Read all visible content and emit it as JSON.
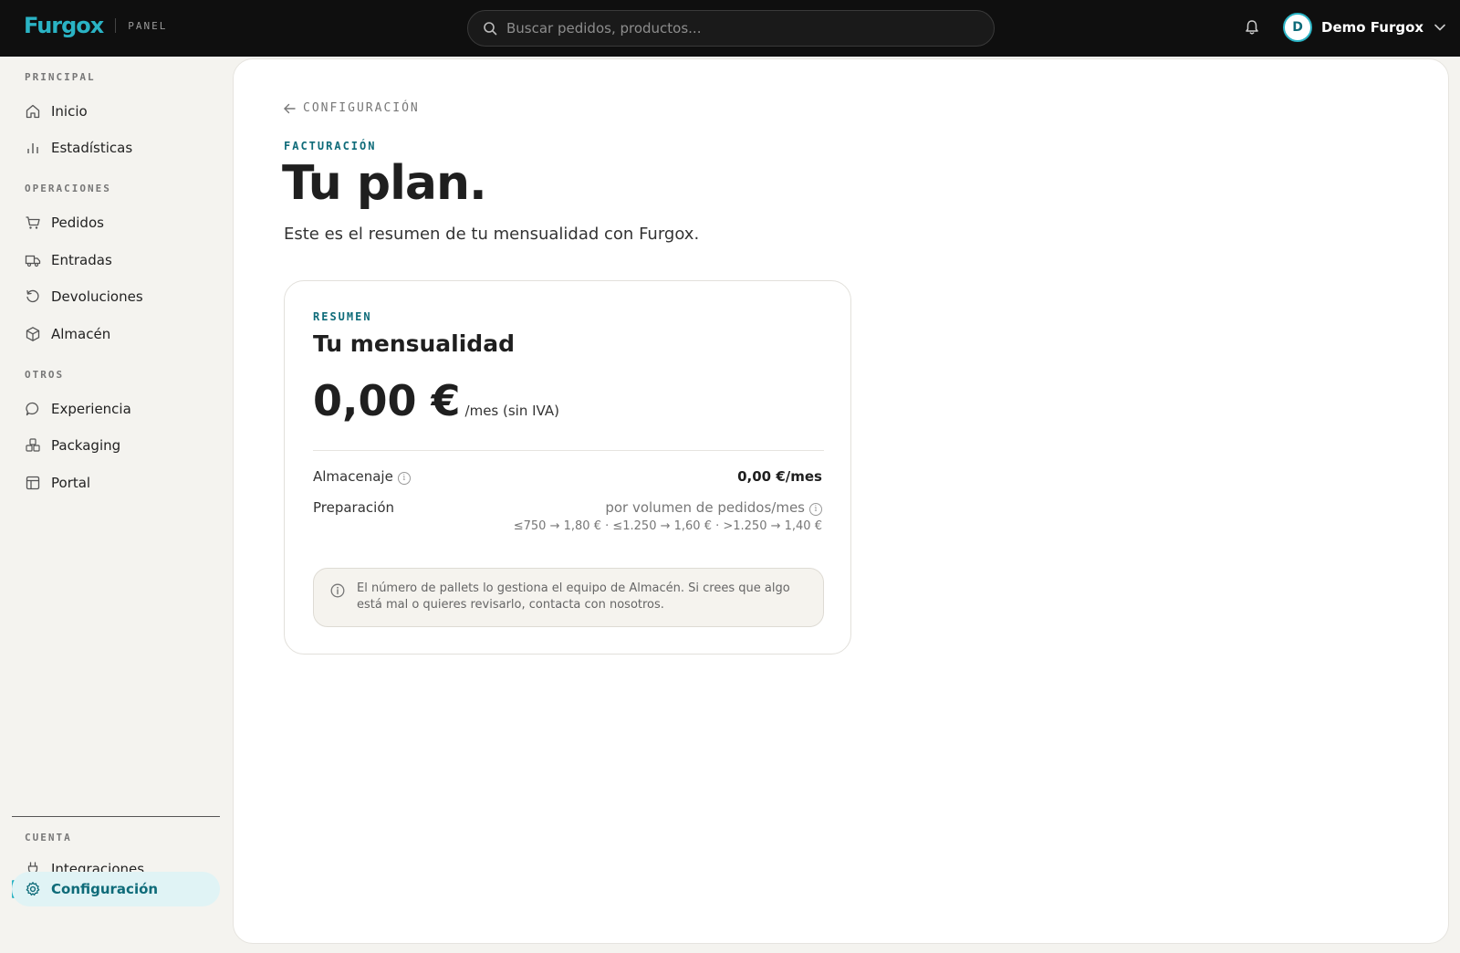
{
  "topbar": {
    "brand": "Furgox",
    "brand_sub": "PANEL",
    "search_placeholder": "Buscar pedidos, productos...",
    "user_initial": "D",
    "user_name": "Demo Furgox"
  },
  "sidebar": {
    "sections": [
      {
        "title": "PRINCIPAL",
        "items": [
          {
            "label": "Inicio",
            "icon": "home-icon"
          },
          {
            "label": "Estadísticas",
            "icon": "bar-chart-icon"
          }
        ]
      },
      {
        "title": "OPERACIONES",
        "items": [
          {
            "label": "Pedidos",
            "icon": "cart-icon"
          },
          {
            "label": "Entradas",
            "icon": "truck-icon"
          },
          {
            "label": "Devoluciones",
            "icon": "return-icon"
          },
          {
            "label": "Almacén",
            "icon": "box-icon"
          }
        ]
      },
      {
        "title": "OTROS",
        "items": [
          {
            "label": "Experiencia",
            "icon": "chat-icon"
          },
          {
            "label": "Packaging",
            "icon": "packages-icon"
          },
          {
            "label": "Portal",
            "icon": "layout-icon"
          }
        ]
      },
      {
        "title": "CUENTA",
        "items": [
          {
            "label": "Integraciones",
            "icon": "plug-icon"
          },
          {
            "label": "Configuración",
            "icon": "gear-icon",
            "active": true
          }
        ]
      }
    ]
  },
  "main": {
    "back_label": "CONFIGURACIÓN",
    "eyebrow": "FACTURACIÓN",
    "title": "Tu plan.",
    "subtitle": "Este es el resumen de tu mensualidad con Furgox.",
    "card": {
      "eyebrow": "RESUMEN",
      "title": "Tu mensualidad",
      "price": "0,00 €",
      "price_unit": "/mes (sin IVA)",
      "rows": {
        "storage_label": "Almacenaje",
        "storage_value": "0,00 €/mes",
        "prep_label": "Preparación",
        "prep_note": "por volumen de pedidos/mes",
        "prep_tiers": "≤750 → 1,80 € · ≤1.250 → 1,60 € · >1.250 → 1,40 €"
      },
      "notice": "El número de pallets lo gestiona el equipo de Almacén. Si crees que algo está mal o quieres revisarlo, contacta con nosotros."
    }
  },
  "colors": {
    "accent": "#2ab3c4",
    "accent_dark": "#0e6b79",
    "topbar": "#0f0f0f",
    "background": "#f4f3ef"
  }
}
